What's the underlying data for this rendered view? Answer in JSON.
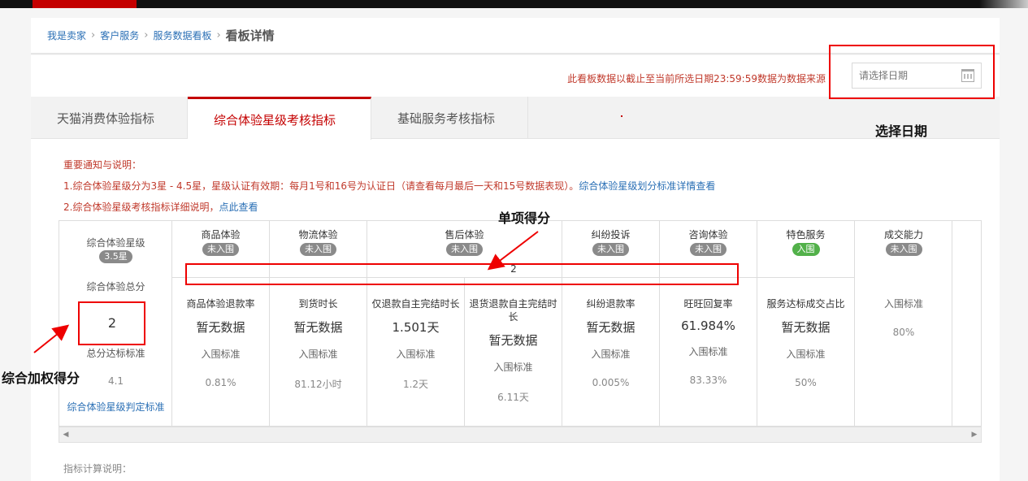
{
  "breadcrumb": {
    "items": [
      "我是卖家",
      "客户服务",
      "服务数据看板"
    ],
    "sep": "›",
    "current": "看板详情"
  },
  "notice_top": "此看板数据以截止至当前所选日期23:59:59数据为数据来源",
  "date_picker": {
    "placeholder": "请选择日期"
  },
  "tabs": [
    "天猫消费体验指标",
    "综合体验星级考核指标",
    "基础服务考核指标"
  ],
  "notes": {
    "heading": "重要通知与说明：",
    "line1": "1.综合体验星级分为3星 - 4.5星，星级认证有效期：每月1号和16号为认证日（请查看每月最后一天和15号数据表现）。",
    "line1_link": "综合体验星级划分标准详情查看",
    "line2": "2.综合体验星级考核指标详细说明，",
    "line2_link": "点此查看"
  },
  "summary": {
    "star_label": "综合体验星级",
    "star_badge": "3.5星",
    "total_label": "综合体验总分",
    "total_value": "2",
    "std_label": "总分达标标准",
    "std_value": "4.1",
    "link": "综合体验星级判定标准"
  },
  "categories": [
    {
      "name": "商品体验",
      "badge": "未入围"
    },
    {
      "name": "物流体验",
      "badge": "未入围"
    },
    {
      "name": "售后体验",
      "badge": "未入围"
    },
    {
      "name": "纠纷投诉",
      "badge": "未入围"
    },
    {
      "name": "咨询体验",
      "badge": "未入围"
    },
    {
      "name": "特色服务",
      "badge": "入围"
    },
    {
      "name": "成交能力",
      "badge": "未入围"
    }
  ],
  "item_score": "2",
  "metrics": [
    {
      "title": "商品体验退款率",
      "value": "暂无数据",
      "std_label": "入围标准",
      "std_value": "0.81%"
    },
    {
      "title": "到货时长",
      "value": "暂无数据",
      "std_label": "入围标准",
      "std_value": "81.12小时"
    },
    {
      "title": "仅退款自主完结时长",
      "value": "1.501天",
      "std_label": "入围标准",
      "std_value": "1.2天"
    },
    {
      "title": "退货退款自主完结时长",
      "value": "暂无数据",
      "std_label": "入围标准",
      "std_value": "6.11天"
    },
    {
      "title": "纠纷退款率",
      "value": "暂无数据",
      "std_label": "入围标准",
      "std_value": "0.005%"
    },
    {
      "title": "旺旺回复率",
      "value": "61.984%",
      "std_label": "入围标准",
      "std_value": "83.33%"
    },
    {
      "title": "服务达标成交占比",
      "value": "暂无数据",
      "std_label": "入围标准",
      "std_value": "50%"
    }
  ],
  "deal_ability": {
    "std_label": "入围标准",
    "std_value": "80%"
  },
  "calc_note": "指标计算说明：",
  "annotations": {
    "select_date": "选择日期",
    "item_score": "单项得分",
    "weighted_score": "综合加权得分"
  },
  "colors": {
    "accent": "#c40000",
    "link": "#2a6fb5",
    "badge_gray": "#8a8a8a",
    "badge_green": "#52b14a",
    "annotation_red": "#e00000"
  }
}
